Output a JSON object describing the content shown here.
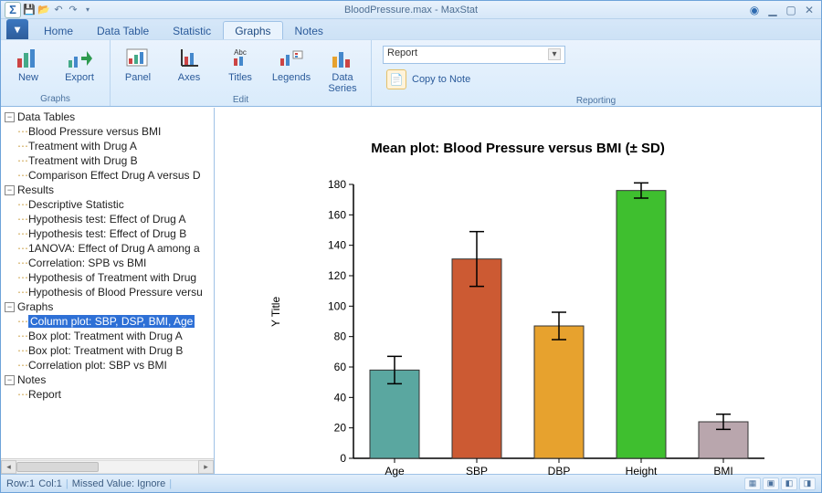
{
  "window": {
    "title": "BloodPressure.max - MaxStat"
  },
  "tabs": {
    "home": "Home",
    "datatable": "Data Table",
    "statistic": "Statistic",
    "graphs": "Graphs",
    "notes": "Notes"
  },
  "ribbon": {
    "groups": {
      "graphs": "Graphs",
      "edit": "Edit",
      "reporting": "Reporting"
    },
    "new": "New",
    "export": "Export",
    "panel": "Panel",
    "axes": "Axes",
    "titles": "Titles",
    "legends": "Legends",
    "dataseries1": "Data",
    "dataseries2": "Series",
    "report_select": "Report",
    "copy_to_note": "Copy to Note"
  },
  "tree": {
    "data_tables": "Data Tables",
    "dt": {
      "a": "Blood Pressure versus BMI",
      "b": "Treatment with Drug A",
      "c": "Treatment with Drug B",
      "d": "Comparison Effect Drug A versus D"
    },
    "results": "Results",
    "rs": {
      "a": "Descriptive Statistic",
      "b": "Hypothesis test: Effect of Drug A",
      "c": "Hypothesis test: Effect of Drug B",
      "d": "1ANOVA: Effect of Drug A among a",
      "e": "Correlation: SPB vs BMI",
      "f": "Hypothesis of Treatment with Drug",
      "g": "Hypothesis of Blood Pressure versu"
    },
    "graphs": "Graphs",
    "gr": {
      "a": "Column plot: SBP, DSP, BMI, Age",
      "b": "Box plot: Treatment with Drug A",
      "c": "Box plot: Treatment with Drug B",
      "d": "Correlation plot: SBP vs BMI"
    },
    "notes": "Notes",
    "nt": {
      "a": "Report"
    }
  },
  "chart_data": {
    "type": "bar",
    "title": "Mean plot: Blood Pressure versus BMI (± SD)",
    "ylabel": "Y Title",
    "ylim": [
      0,
      180
    ],
    "yticks": [
      0,
      20,
      40,
      60,
      80,
      100,
      120,
      140,
      160,
      180
    ],
    "categories": [
      "Age",
      "SBP",
      "DBP",
      "Height",
      "BMI"
    ],
    "values": [
      58,
      131,
      87,
      176,
      24
    ],
    "error_sd": [
      9,
      18,
      9,
      5,
      5
    ],
    "colors": [
      "#5aa7a0",
      "#cc5a33",
      "#e7a22e",
      "#3fbf2f",
      "#b9a6ad"
    ]
  },
  "status": {
    "row": "Row:1",
    "col": "Col:1",
    "missed": "Missed Value: Ignore"
  }
}
